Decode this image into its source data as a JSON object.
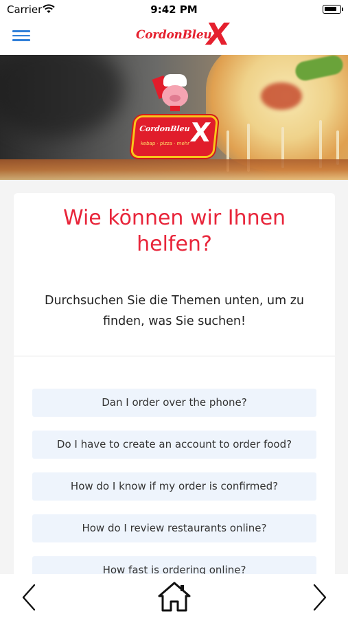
{
  "status_bar": {
    "carrier": "Carrier",
    "time": "9:42 PM"
  },
  "header": {
    "brand_word": "CordonBleu",
    "brand_x": "X",
    "menu_icon": "hamburger-icon",
    "accent_color": "#e5202e",
    "menu_color": "#2f7fd8"
  },
  "hero": {
    "badge_word": "CordonBleu",
    "badge_x": "X",
    "badge_sub": "kebap · pizza · mehr"
  },
  "help": {
    "title": "Wie können wir Ihnen helfen?",
    "subtitle": "Durchsuchen Sie die Themen unten, um zu finden, was Sie suchen!",
    "faqs": [
      "Dan I order over the phone?",
      "Do I have to create an account to order food?",
      "How do I know if my order is confirmed?",
      "How do I review restaurants online?",
      "How fast is ordering online?"
    ]
  },
  "bottom_nav": {
    "back_icon": "chevron-left-icon",
    "home_icon": "home-icon",
    "forward_icon": "chevron-right-icon"
  }
}
